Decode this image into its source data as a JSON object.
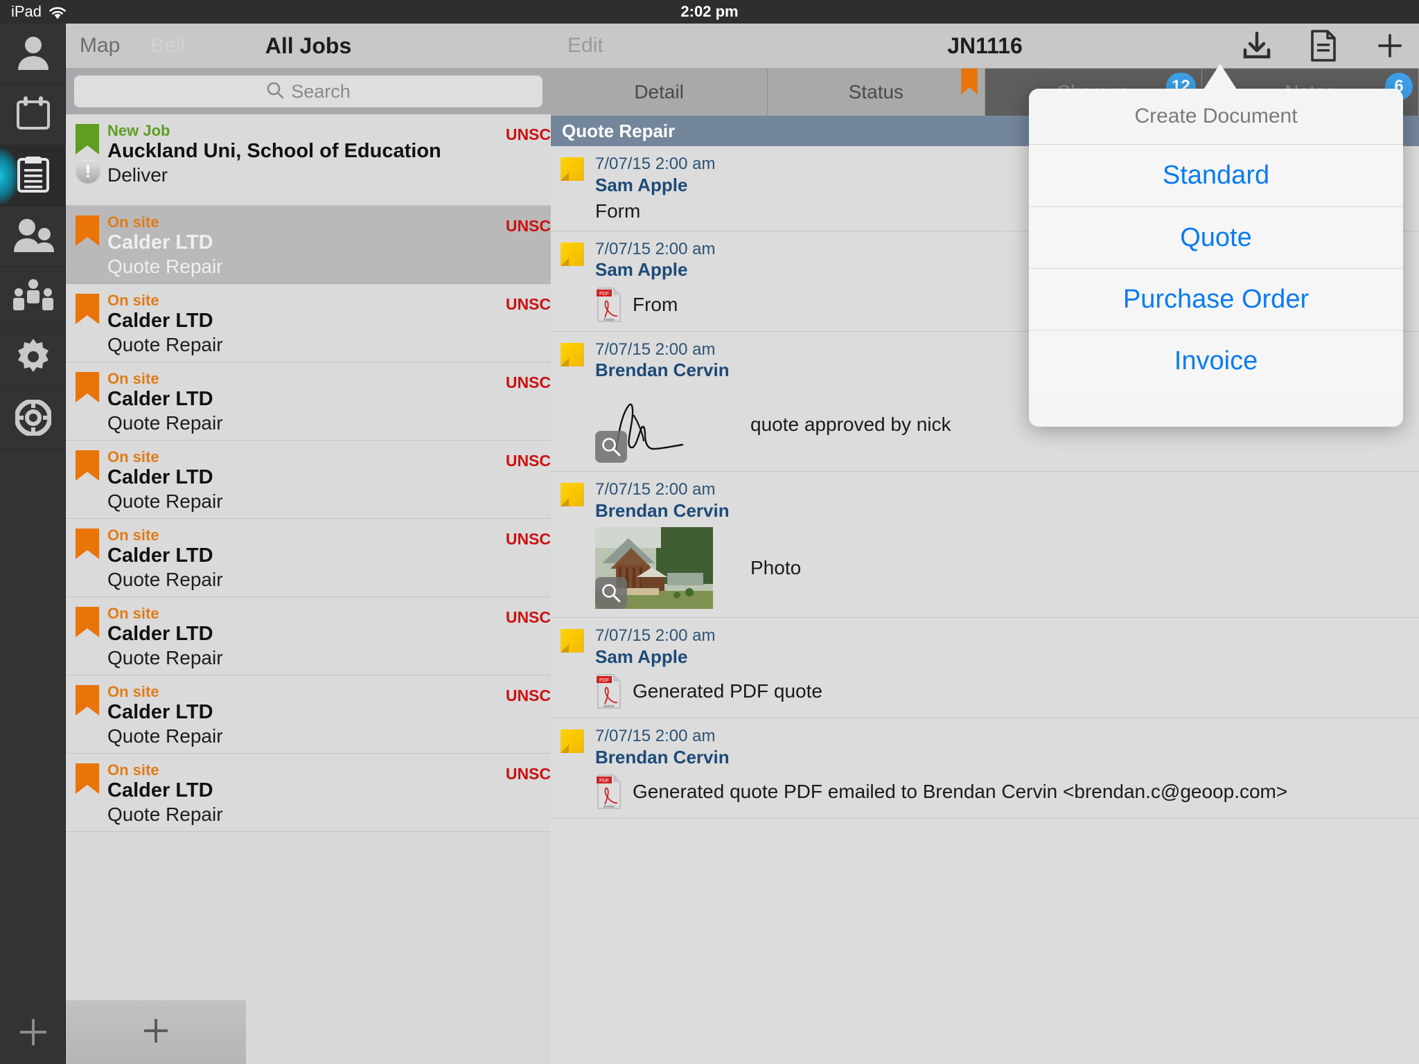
{
  "statusbar": {
    "device": "iPad",
    "time": "2:02 pm",
    "wifi_icon": "wifi-icon"
  },
  "rail": {
    "items": [
      {
        "name": "user-icon",
        "label": "User",
        "active": false
      },
      {
        "name": "calendar-icon",
        "label": "Calendar",
        "active": false
      },
      {
        "name": "clipboard-icon",
        "label": "Jobs",
        "active": true
      },
      {
        "name": "contacts-icon",
        "label": "Contacts",
        "active": false
      },
      {
        "name": "team-icon",
        "label": "Team",
        "active": false
      },
      {
        "name": "gear-icon",
        "label": "Settings",
        "active": false
      },
      {
        "name": "lifebuoy-icon",
        "label": "Help",
        "active": false
      }
    ],
    "add_label": "+"
  },
  "master": {
    "navbar": {
      "map_label": "Map",
      "bell_label": "Bell",
      "title": "All Jobs"
    },
    "search": {
      "placeholder": "Search",
      "icon": "search-icon"
    },
    "add_label": "+",
    "jobs": [
      {
        "status": "New Job",
        "status_color": "green",
        "title": "Auckland Uni, School of Education",
        "subtitle": "Deliver",
        "sync": "UNSC",
        "selected": false,
        "warn": "!"
      },
      {
        "status": "On site",
        "status_color": "orange",
        "title": "Calder LTD",
        "subtitle": "Quote Repair",
        "sync": "UNSC",
        "selected": true,
        "warn": ""
      },
      {
        "status": "On site",
        "status_color": "orange",
        "title": "Calder LTD",
        "subtitle": "Quote Repair",
        "sync": "UNSC",
        "selected": false,
        "warn": ""
      },
      {
        "status": "On site",
        "status_color": "orange",
        "title": "Calder LTD",
        "subtitle": "Quote Repair",
        "sync": "UNSC",
        "selected": false,
        "warn": ""
      },
      {
        "status": "On site",
        "status_color": "orange",
        "title": "Calder LTD",
        "subtitle": "Quote Repair",
        "sync": "UNSC",
        "selected": false,
        "warn": ""
      },
      {
        "status": "On site",
        "status_color": "orange",
        "title": "Calder LTD",
        "subtitle": "Quote Repair",
        "sync": "UNSC",
        "selected": false,
        "warn": ""
      },
      {
        "status": "On site",
        "status_color": "orange",
        "title": "Calder LTD",
        "subtitle": "Quote Repair",
        "sync": "UNSC",
        "selected": false,
        "warn": ""
      },
      {
        "status": "On site",
        "status_color": "orange",
        "title": "Calder LTD",
        "subtitle": "Quote Repair",
        "sync": "UNSC",
        "selected": false,
        "warn": ""
      },
      {
        "status": "On site",
        "status_color": "orange",
        "title": "Calder LTD",
        "subtitle": "Quote Repair",
        "sync": "UNSC",
        "selected": false,
        "warn": ""
      }
    ]
  },
  "detail": {
    "navbar": {
      "edit_label": "Edit",
      "title": "JN1116",
      "actions": [
        {
          "name": "download-icon",
          "label": "Download"
        },
        {
          "name": "document-icon",
          "label": "Document"
        },
        {
          "name": "add-icon",
          "label": "Add"
        }
      ]
    },
    "tabs": [
      {
        "label": "Detail",
        "badge": "",
        "flag": false,
        "dim": false
      },
      {
        "label": "Status",
        "badge": "",
        "flag": true,
        "dim": false
      },
      {
        "label": "Charges",
        "badge": "12",
        "flag": false,
        "dim": true
      },
      {
        "label": "Notes",
        "badge": "6",
        "flag": false,
        "dim": true
      }
    ],
    "section_header": "Quote Repair",
    "notes": [
      {
        "time": "7/07/15 2:00 am",
        "author": "Sam Apple",
        "kind": "text",
        "text": "Form"
      },
      {
        "time": "7/07/15 2:00 am",
        "author": "Sam Apple",
        "kind": "pdf",
        "text": "From"
      },
      {
        "time": "7/07/15 2:00 am",
        "author": "Brendan Cervin",
        "kind": "signature",
        "text": "quote approved by nick"
      },
      {
        "time": "7/07/15 2:00 am",
        "author": "Brendan Cervin",
        "kind": "photo",
        "text": "Photo"
      },
      {
        "time": "7/07/15 2:00 am",
        "author": "Sam Apple",
        "kind": "pdf",
        "text": "Generated PDF quote"
      },
      {
        "time": "7/07/15 2:00 am",
        "author": "Brendan Cervin",
        "kind": "pdf",
        "text": "Generated quote PDF emailed to Brendan Cervin <brendan.c@geoop.com>"
      }
    ]
  },
  "popover": {
    "title": "Create Document",
    "items": [
      {
        "label": "Standard"
      },
      {
        "label": "Quote"
      },
      {
        "label": "Purchase Order"
      },
      {
        "label": "Invoice"
      }
    ]
  },
  "colors": {
    "accent_blue": "#0a7bf2",
    "badge_blue": "#3da0e8",
    "flag_orange": "#e8740a",
    "flag_green": "#5f9e22",
    "unsync_red": "#cc1111",
    "section_blue": "#74869c",
    "note_yellow": "#ffd400"
  }
}
